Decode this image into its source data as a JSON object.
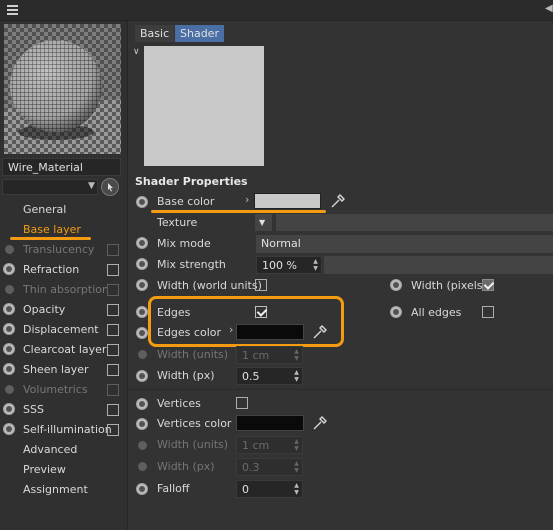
{
  "material": {
    "name": "Wire_Material",
    "channels": [
      {
        "label": "General",
        "radio": "none",
        "check": "none"
      },
      {
        "label": "Base layer",
        "radio": "none",
        "check": "none",
        "active": true
      },
      {
        "label": "Translucency",
        "radio": "dim",
        "check": "dim"
      },
      {
        "label": "Refraction",
        "radio": "on",
        "check": "off"
      },
      {
        "label": "Thin absorption",
        "radio": "dim",
        "check": "dim"
      },
      {
        "label": "Opacity",
        "radio": "on",
        "check": "off"
      },
      {
        "label": "Displacement",
        "radio": "on",
        "check": "off"
      },
      {
        "label": "Clearcoat layer",
        "radio": "on",
        "check": "off"
      },
      {
        "label": "Sheen layer",
        "radio": "on",
        "check": "off"
      },
      {
        "label": "Volumetrics",
        "radio": "dim",
        "check": "dim"
      },
      {
        "label": "SSS",
        "radio": "on",
        "check": "off"
      },
      {
        "label": "Self-illumination",
        "radio": "on",
        "check": "off"
      },
      {
        "label": "Advanced",
        "radio": "none",
        "check": "none"
      },
      {
        "label": "Preview",
        "radio": "none",
        "check": "none"
      },
      {
        "label": "Assignment",
        "radio": "none",
        "check": "none"
      }
    ]
  },
  "tabs": {
    "basic": "Basic",
    "shader": "Shader"
  },
  "section_title": "Shader Properties",
  "props": {
    "base_color": {
      "label": "Base color",
      "value": "#c8c8c8"
    },
    "texture": {
      "label": "Texture"
    },
    "mix_mode": {
      "label": "Mix mode",
      "value": "Normal"
    },
    "mix_strength": {
      "label": "Mix strength",
      "value": "100 %"
    },
    "width_world": {
      "label": "Width (world units)"
    },
    "width_pixels": {
      "label": "Width (pixels)"
    },
    "edges": {
      "label": "Edges"
    },
    "all_edges": {
      "label": "All edges"
    },
    "edges_color": {
      "label": "Edges color",
      "value": "#0a0a0a"
    },
    "edge_width_units": {
      "label": "Width (units)",
      "value": "1 cm"
    },
    "edge_width_px": {
      "label": "Width (px)",
      "value": "0.5"
    },
    "vertices": {
      "label": "Vertices"
    },
    "vertices_color": {
      "label": "Vertices color",
      "value": "#0a0a0a"
    },
    "vert_width_units": {
      "label": "Width (units)",
      "value": "1 cm"
    },
    "vert_width_px": {
      "label": "Width (px)",
      "value": "0.3"
    },
    "falloff": {
      "label": "Falloff",
      "value": "0"
    }
  },
  "colors": {
    "highlight": "#f39c12",
    "active_tab": "#4a6fa5",
    "active_channel": "#f39c12"
  },
  "icons": {
    "menu": "hamburger-icon",
    "picker": "eyedropper-icon",
    "pick": "pick-cursor-icon"
  }
}
